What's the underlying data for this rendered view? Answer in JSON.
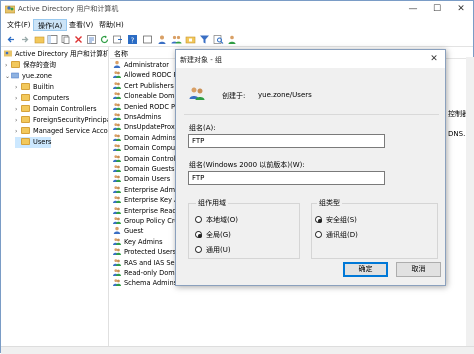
{
  "window": {
    "title": "Active Directory 用户和计算机"
  },
  "menu": [
    "文件(F)",
    "操作(A)",
    "查看(V)",
    "帮助(H)"
  ],
  "tree": {
    "root": "Active Directory 用户和计算机",
    "saved_queries": "保存的查询",
    "domain": "yue.zone",
    "children": [
      "Builtin",
      "Computers",
      "Domain Controllers",
      "ForeignSecurityPrincipals",
      "Managed Service Accounts",
      "Users"
    ]
  },
  "list": {
    "column_name": "名称",
    "items": [
      "Administrator",
      "Allowed RODC Pa",
      "Cert Publishers",
      "Cloneable Doma",
      "Denied RODC Pa",
      "DnsAdmins",
      "DnsUpdateProxy",
      "Domain Admins",
      "Domain Compute",
      "Domain Controll",
      "Domain Guests",
      "Domain Users",
      "Enterprise Admi",
      "Enterprise Key A",
      "Enterprise Read",
      "Group Policy Cre",
      "Guest",
      "Key Admins",
      "Protected Users",
      "RAS and IAS Ser",
      "Read-only Doma",
      "Schema Admins"
    ],
    "right_edge_texts": [
      "控制器",
      "DNS..."
    ]
  },
  "dialog": {
    "title": "新建对象 - 组",
    "create_in_label": "创建于:",
    "create_in_path": "yue.zone/Users",
    "group_name_label": "组名(A):",
    "group_name_value": "FTP",
    "pre2000_label": "组名(Windows 2000 以前版本)(W):",
    "pre2000_value": "FTP",
    "scope": {
      "title": "组作用域",
      "options": [
        "本地域(O)",
        "全局(G)",
        "通用(U)"
      ],
      "selected": "全局(G)"
    },
    "type": {
      "title": "组类型",
      "options": [
        "安全组(S)",
        "通讯组(D)"
      ],
      "selected": "安全组(S)"
    },
    "ok": "确定",
    "cancel": "取消"
  }
}
